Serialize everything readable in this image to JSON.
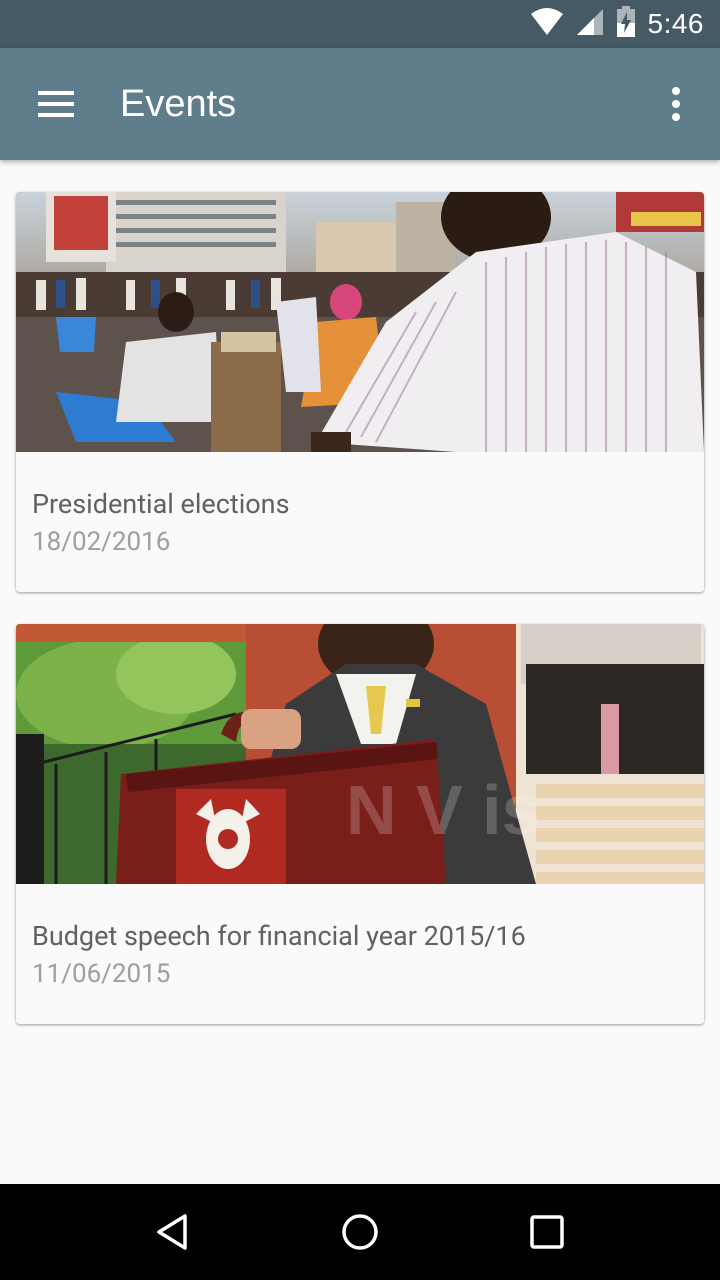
{
  "status_bar": {
    "time": "5:46",
    "icons": [
      "wifi-icon",
      "cell-signal-icon",
      "battery-icon"
    ]
  },
  "app_bar": {
    "title": "Events",
    "menu_icon": "hamburger-menu-icon",
    "overflow_icon": "more-vert-icon"
  },
  "events": [
    {
      "title": "Presidential elections",
      "date": "18/02/2016",
      "image": "election-photo"
    },
    {
      "title": "Budget speech for financial year 2015/16",
      "date": "11/06/2015",
      "image": "budget-briefcase-photo"
    }
  ],
  "nav_bar": {
    "buttons": [
      "back-icon",
      "home-icon",
      "recents-icon"
    ]
  },
  "colors": {
    "status_bar": "#455a64",
    "app_bar": "#607d8b",
    "background": "#fafafa"
  }
}
